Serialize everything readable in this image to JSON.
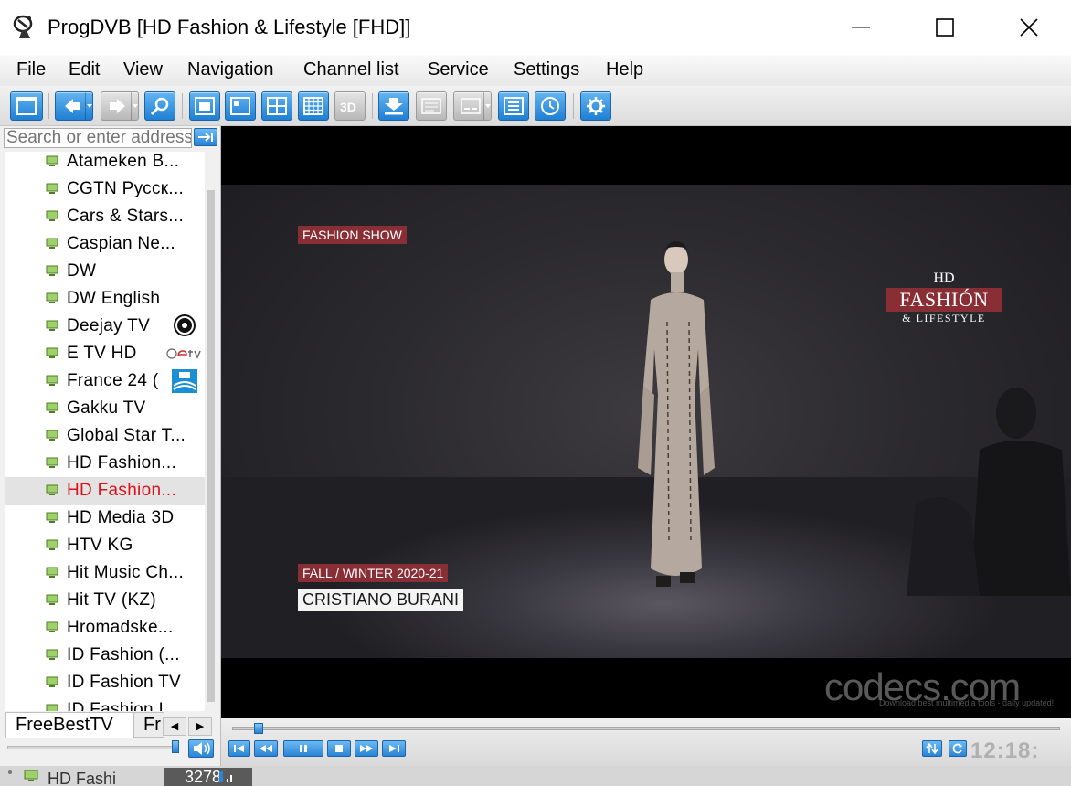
{
  "window": {
    "title": "ProgDVB [HD Fashion & Lifestyle [FHD]]"
  },
  "menu": [
    "File",
    "Edit",
    "View",
    "Navigation",
    "Channel list",
    "Service",
    "Settings",
    "Help"
  ],
  "sidebar": {
    "search_placeholder": "Search or enter address",
    "channels": [
      {
        "label": "Atameken B..."
      },
      {
        "label": "CGTN Русск..."
      },
      {
        "label": "Cars & Stars..."
      },
      {
        "label": "Caspian Ne..."
      },
      {
        "label": "DW"
      },
      {
        "label": "DW English"
      },
      {
        "label": "Deejay TV",
        "logo": "DEE JAY"
      },
      {
        "label": "E TV HD",
        "logo": "etv"
      },
      {
        "label": "France 24 (",
        "logo": "FRANCE 24"
      },
      {
        "label": "Gakku TV"
      },
      {
        "label": "Global Star T..."
      },
      {
        "label": "HD Fashion..."
      },
      {
        "label": "HD Fashion...",
        "selected": true
      },
      {
        "label": "HD Media 3D"
      },
      {
        "label": "HTV KG"
      },
      {
        "label": "Hit Music Ch..."
      },
      {
        "label": "Hit TV (KZ)"
      },
      {
        "label": "Hromadske..."
      },
      {
        "label": "ID Fashion (..."
      },
      {
        "label": "ID Fashion TV"
      },
      {
        "label": "ID Fashion I..."
      }
    ],
    "tabs": [
      {
        "label": "FreeBestTV",
        "active": true
      },
      {
        "label": "Fr"
      }
    ]
  },
  "video": {
    "tag_top": "FASHION SHOW",
    "season": "FALL / WINTER 2020-21",
    "designer": "CRISTIANO BURANI",
    "brand_hd": "HD",
    "brand_main": "FASHIÓN",
    "brand_sub": "& LIFESTYLE",
    "watermark": "codecs.com",
    "watermark_sub": "Download best multimedia tools - daily updated!"
  },
  "player": {
    "clock": "12:18:"
  },
  "status": {
    "channel": "HD Fashi",
    "bitrate": "3278"
  },
  "colors": {
    "accent_blue": "#2b84d6",
    "selected_text": "#e0101a",
    "brand_red": "#8a2e35"
  }
}
